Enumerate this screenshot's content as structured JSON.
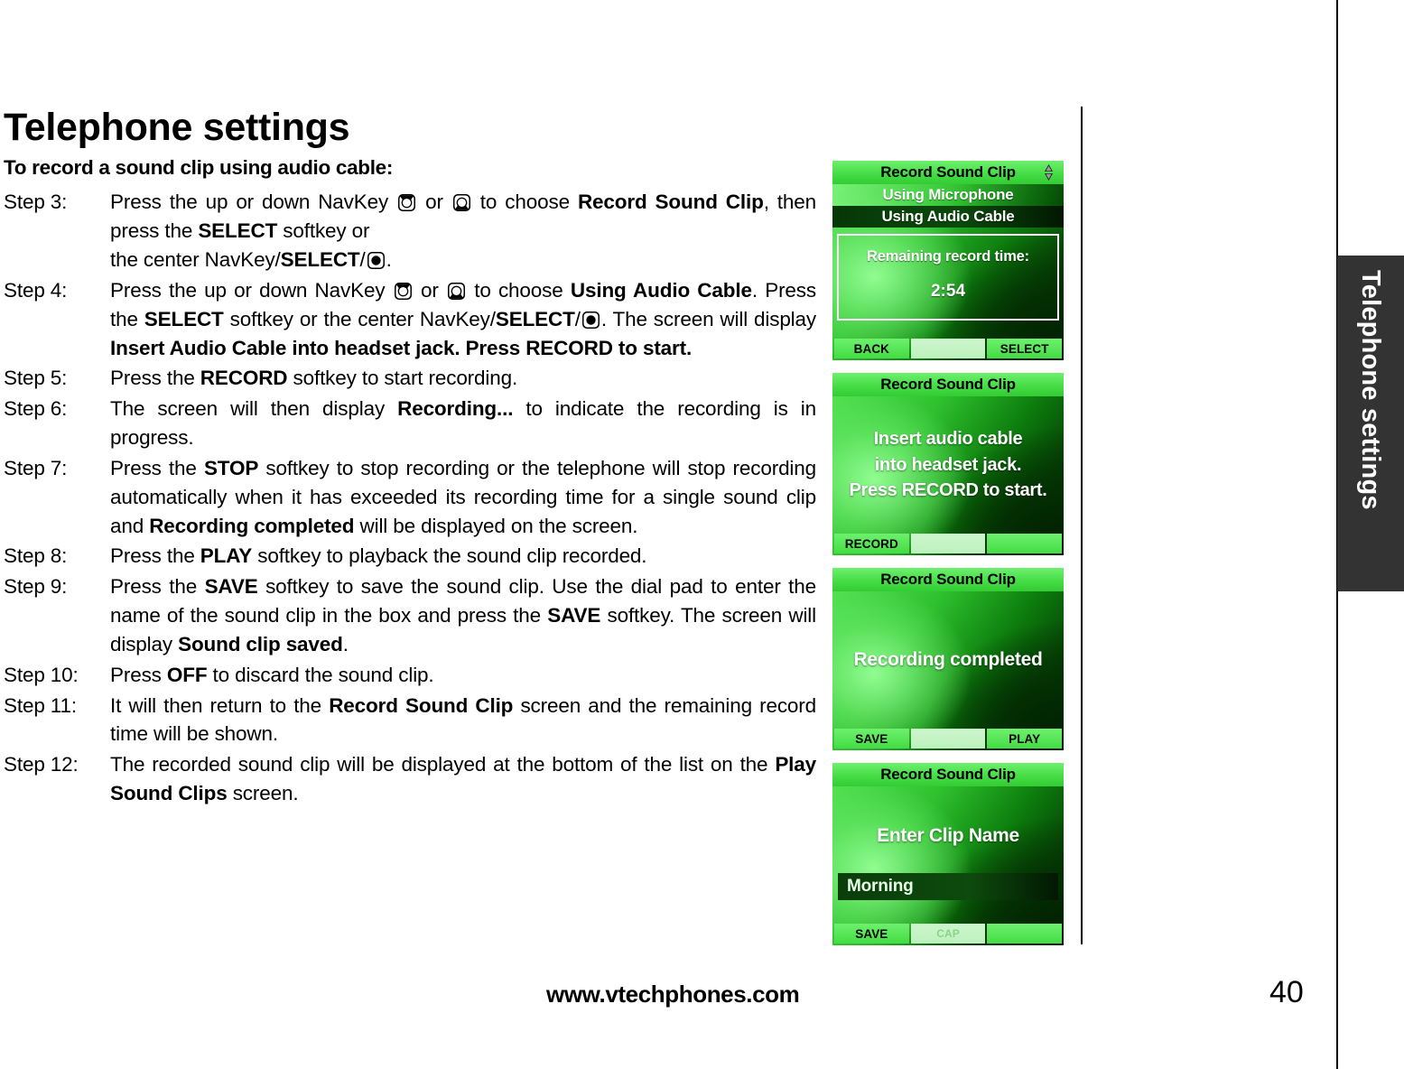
{
  "page": {
    "title": "Telephone settings",
    "intro": "To record a sound clip using audio cable:",
    "side_tab_label": "Telephone settings",
    "footer_url": "www.vtechphones.com",
    "footer_page": "40"
  },
  "steps": [
    {
      "label": "Step 3:",
      "html": "Press the up or down NavKey <span class=\"navkey\" data-name=\"navkey-up-icon\" data-interactable=\"false\"><svg width=\"21\" height=\"21\" viewBox=\"0 0 21 21\"><rect x=\"1\" y=\"1\" width=\"19\" height=\"19\" rx=\"5\" fill=\"#000\"/><rect x=\"2.5\" y=\"2.5\" width=\"16\" height=\"16\" rx=\"4\" fill=\"#fff\"/><path d=\"M2.6 2.6 L18.4 2.6 L14.6 8.0 A5.2 5.2 0 0 0 6.4 8.0 Z\" fill=\"#000\"/><circle cx=\"10.5\" cy=\"10.5\" r=\"5.2\" fill=\"none\" stroke=\"#000\" stroke-width=\"1.3\"/></svg></span> or <span class=\"navkey\" data-name=\"navkey-down-icon\" data-interactable=\"false\"><svg width=\"21\" height=\"21\" viewBox=\"0 0 21 21\"><rect x=\"1\" y=\"1\" width=\"19\" height=\"19\" rx=\"5\" fill=\"#000\"/><rect x=\"2.5\" y=\"2.5\" width=\"16\" height=\"16\" rx=\"4\" fill=\"#fff\"/><path d=\"M2.6 18.4 L18.4 18.4 L14.6 13.0 A5.2 5.2 0 0 1 6.4 13.0 Z\" fill=\"#000\"/><circle cx=\"10.5\" cy=\"10.5\" r=\"5.2\" fill=\"none\" stroke=\"#000\" stroke-width=\"1.3\"/></svg></span> to choose <b>Record Sound Clip</b>, then press the <b>SELECT</b> softkey or<br>the center NavKey/<b>SELECT</b>/<span class=\"navkey\" data-name=\"navkey-center-icon\" data-interactable=\"false\"><svg width=\"21\" height=\"21\" viewBox=\"0 0 21 21\"><rect x=\"1\" y=\"1\" width=\"19\" height=\"19\" rx=\"5\" fill=\"#000\"/><rect x=\"2.5\" y=\"2.5\" width=\"16\" height=\"16\" rx=\"4\" fill=\"#fff\"/><circle cx=\"10.5\" cy=\"10.5\" r=\"5.2\" fill=\"#000\"/></svg></span>."
    },
    {
      "label": "Step 4:",
      "html": "Press the up or down NavKey <span class=\"navkey\" data-name=\"navkey-up-icon\" data-interactable=\"false\"><svg width=\"21\" height=\"21\" viewBox=\"0 0 21 21\"><rect x=\"1\" y=\"1\" width=\"19\" height=\"19\" rx=\"5\" fill=\"#000\"/><rect x=\"2.5\" y=\"2.5\" width=\"16\" height=\"16\" rx=\"4\" fill=\"#fff\"/><path d=\"M2.6 2.6 L18.4 2.6 L14.6 8.0 A5.2 5.2 0 0 0 6.4 8.0 Z\" fill=\"#000\"/><circle cx=\"10.5\" cy=\"10.5\" r=\"5.2\" fill=\"none\" stroke=\"#000\" stroke-width=\"1.3\"/></svg></span> or <span class=\"navkey\" data-name=\"navkey-down-icon\" data-interactable=\"false\"><svg width=\"21\" height=\"21\" viewBox=\"0 0 21 21\"><rect x=\"1\" y=\"1\" width=\"19\" height=\"19\" rx=\"5\" fill=\"#000\"/><rect x=\"2.5\" y=\"2.5\" width=\"16\" height=\"16\" rx=\"4\" fill=\"#fff\"/><path d=\"M2.6 18.4 L18.4 18.4 L14.6 13.0 A5.2 5.2 0 0 1 6.4 13.0 Z\" fill=\"#000\"/><circle cx=\"10.5\" cy=\"10.5\" r=\"5.2\" fill=\"none\" stroke=\"#000\" stroke-width=\"1.3\"/></svg></span> to choose <b>Using Audio Cable</b>. Press the <b>SELECT</b> softkey or the center NavKey/<b>SELECT</b>/<span class=\"navkey\" data-name=\"navkey-center-icon\" data-interactable=\"false\"><svg width=\"21\" height=\"21\" viewBox=\"0 0 21 21\"><rect x=\"1\" y=\"1\" width=\"19\" height=\"19\" rx=\"5\" fill=\"#000\"/><rect x=\"2.5\" y=\"2.5\" width=\"16\" height=\"16\" rx=\"4\" fill=\"#fff\"/><circle cx=\"10.5\" cy=\"10.5\" r=\"5.2\" fill=\"#000\"/></svg></span>. The screen will display <b>Insert Audio Cable into headset jack. Press RECORD to start.</b>"
    },
    {
      "label": "Step 5:",
      "html": "Press the <b>RECORD</b> softkey to start recording."
    },
    {
      "label": "Step 6:",
      "html": "The screen will then display <b>Recording...</b> to indicate the recording is in progress."
    },
    {
      "label": "Step 7:",
      "html": "Press the <b>STOP</b> softkey to stop recording or the telephone will stop recording automatically when it has exceeded its recording time for a single sound clip and <b>Recording completed</b> will be displayed on the screen."
    },
    {
      "label": "Step 8:",
      "html": "Press the <b>PLAY</b> softkey to playback the sound clip recorded."
    },
    {
      "label": "Step 9:",
      "html": "Press the <b>SAVE</b> softkey to save the sound clip. Use the dial pad to enter the name of the sound clip in the box and press the <b>SAVE</b> softkey.  The screen will display <b>Sound clip saved</b>."
    },
    {
      "label": "Step 10:",
      "html": "Press <b>OFF</b> to discard the sound clip."
    },
    {
      "label": "Step 11:",
      "html": "It will then return to the <b>Record Sound Clip</b> screen and the remaining record time will be shown."
    },
    {
      "label": "Step 12:",
      "html": "The recorded sound clip will be displayed at the bottom of the list on the <b>Play Sound Clips</b> screen."
    }
  ],
  "screens": [
    {
      "title": "Record Sound Clip",
      "scroll_indicator": "up-down-arrow-icon",
      "menu_items": [
        {
          "label": "Using Microphone",
          "selected": false
        },
        {
          "label": "Using Audio Cable",
          "selected": true
        }
      ],
      "info_box": {
        "line1": "Remaining record time:",
        "line2": "2:54"
      },
      "softkeys": {
        "left": "BACK",
        "center": "",
        "right": "SELECT"
      }
    },
    {
      "title": "Record Sound Clip",
      "body_lines": [
        "Insert audio cable",
        "into headset jack.",
        "Press RECORD to start."
      ],
      "softkeys": {
        "left": "RECORD",
        "center": "",
        "right": ""
      }
    },
    {
      "title": "Record Sound Clip",
      "body_lines": [
        "Recording completed"
      ],
      "softkeys": {
        "left": "SAVE",
        "center": "",
        "right": "PLAY"
      }
    },
    {
      "title": "Record Sound Clip",
      "body_lines": [
        "Enter Clip Name"
      ],
      "name_field_value": "Morning",
      "softkeys": {
        "left": "SAVE",
        "center": "CAP",
        "right": ""
      }
    }
  ],
  "colors": {
    "screen_bright_green": "#46dd46",
    "screen_dark_green": "#063706",
    "softkey_center": "#cdf6cd",
    "side_tab_bg": "#333333"
  }
}
